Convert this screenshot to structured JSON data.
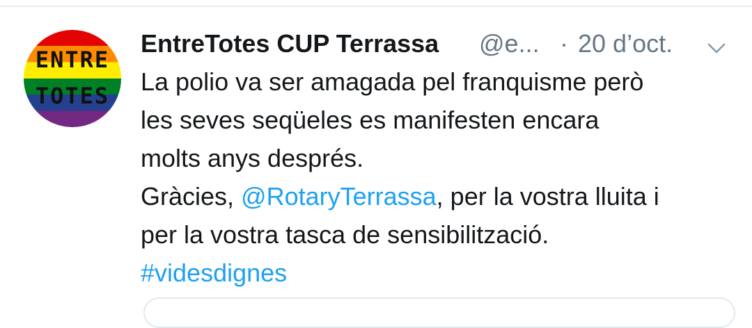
{
  "tweet": {
    "avatar": {
      "line1": "ENTRE",
      "line2": "TOTES"
    },
    "display_name": "EntreTotes CUP Terrassa",
    "handle": "@e...",
    "separator": "·",
    "timestamp": "20 d’oct.",
    "menu_icon": "chevron-down-icon",
    "text": {
      "line1": "La polio va ser amagada pel franquisme però",
      "line2": "les seves seqüeles es manifesten encara",
      "line3": "molts anys després.",
      "line4_before": "Gràcies, ",
      "line4_mention": "@RotaryTerrassa",
      "line4_after": ", per la vostra lluita i",
      "line5": "per la vostra tasca de sensibilització.",
      "hashtag": "#videsdignes"
    }
  },
  "colors": {
    "text": "#14171a",
    "muted": "#657786",
    "link": "#1da1f2",
    "divider": "#e6ecf0"
  }
}
